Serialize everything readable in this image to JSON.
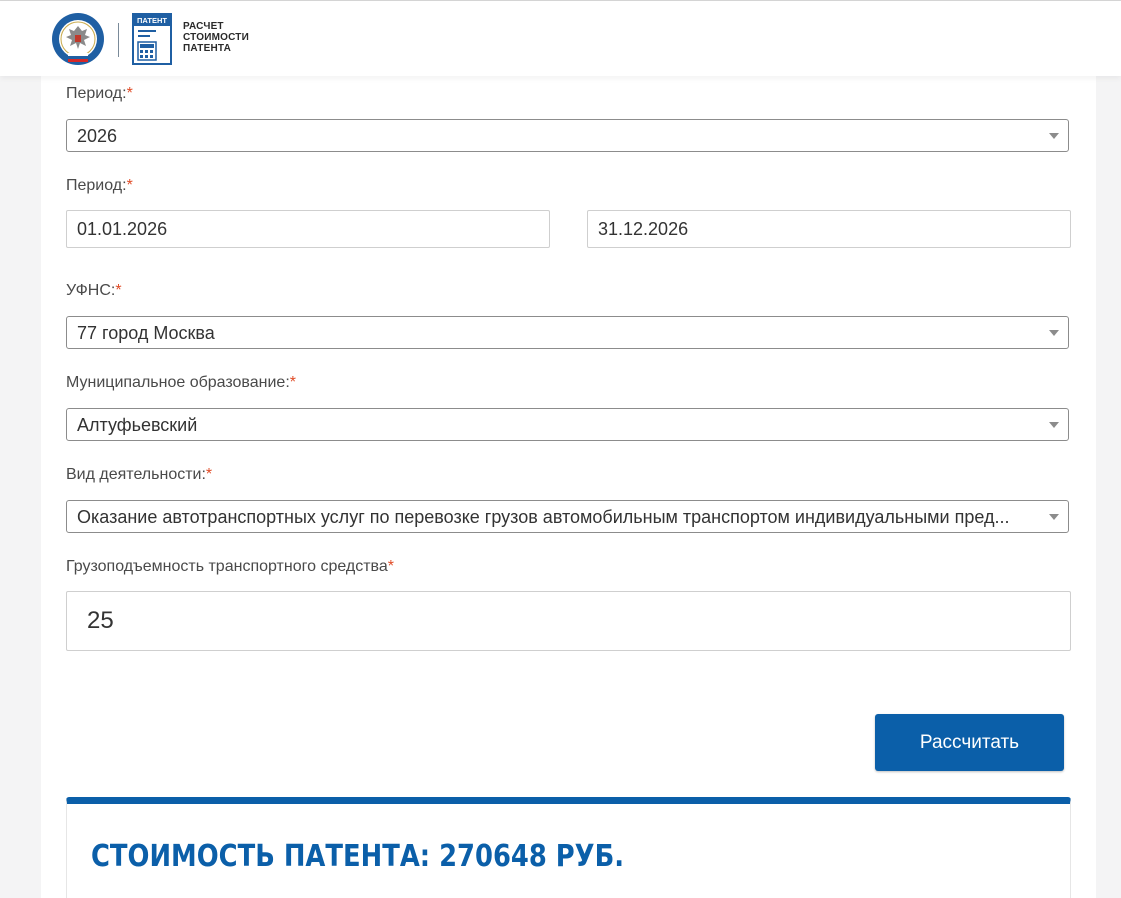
{
  "header": {
    "patent_badge": "ПАТЕНТ",
    "title_line1": "РАСЧЕТ",
    "title_line2": "СТОИМОСТИ",
    "title_line3": "ПАТЕНТА",
    "emblem_ring_text": "ФЕДЕРАЛЬНАЯ НАЛОГОВАЯ СЛУЖБА"
  },
  "colors": {
    "accent": "#0b5fa9",
    "required_mark": "#e04b26",
    "page_bg": "#f4f4f5"
  },
  "form": {
    "required_mark": "*",
    "period_year": {
      "label": "Период:",
      "value": "2026"
    },
    "period_dates": {
      "label": "Период:",
      "start": "01.01.2026",
      "end": "31.12.2026"
    },
    "ufns": {
      "label": "УФНС:",
      "value": "77 город Москва"
    },
    "municipality": {
      "label": "Муниципальное образование:",
      "value": "Алтуфьевский"
    },
    "activity": {
      "label": "Вид деятельности:",
      "value": "Оказание автотранспортных услуг по перевозке грузов автомобильным транспортом индивидуальными пред..."
    },
    "capacity": {
      "label": "Грузоподъемность транспортного средства",
      "value": "25"
    }
  },
  "actions": {
    "calculate_label": "Рассчитать"
  },
  "result": {
    "text": "СТОИМОСТЬ ПАТЕНТА: 270648 РУБ."
  }
}
